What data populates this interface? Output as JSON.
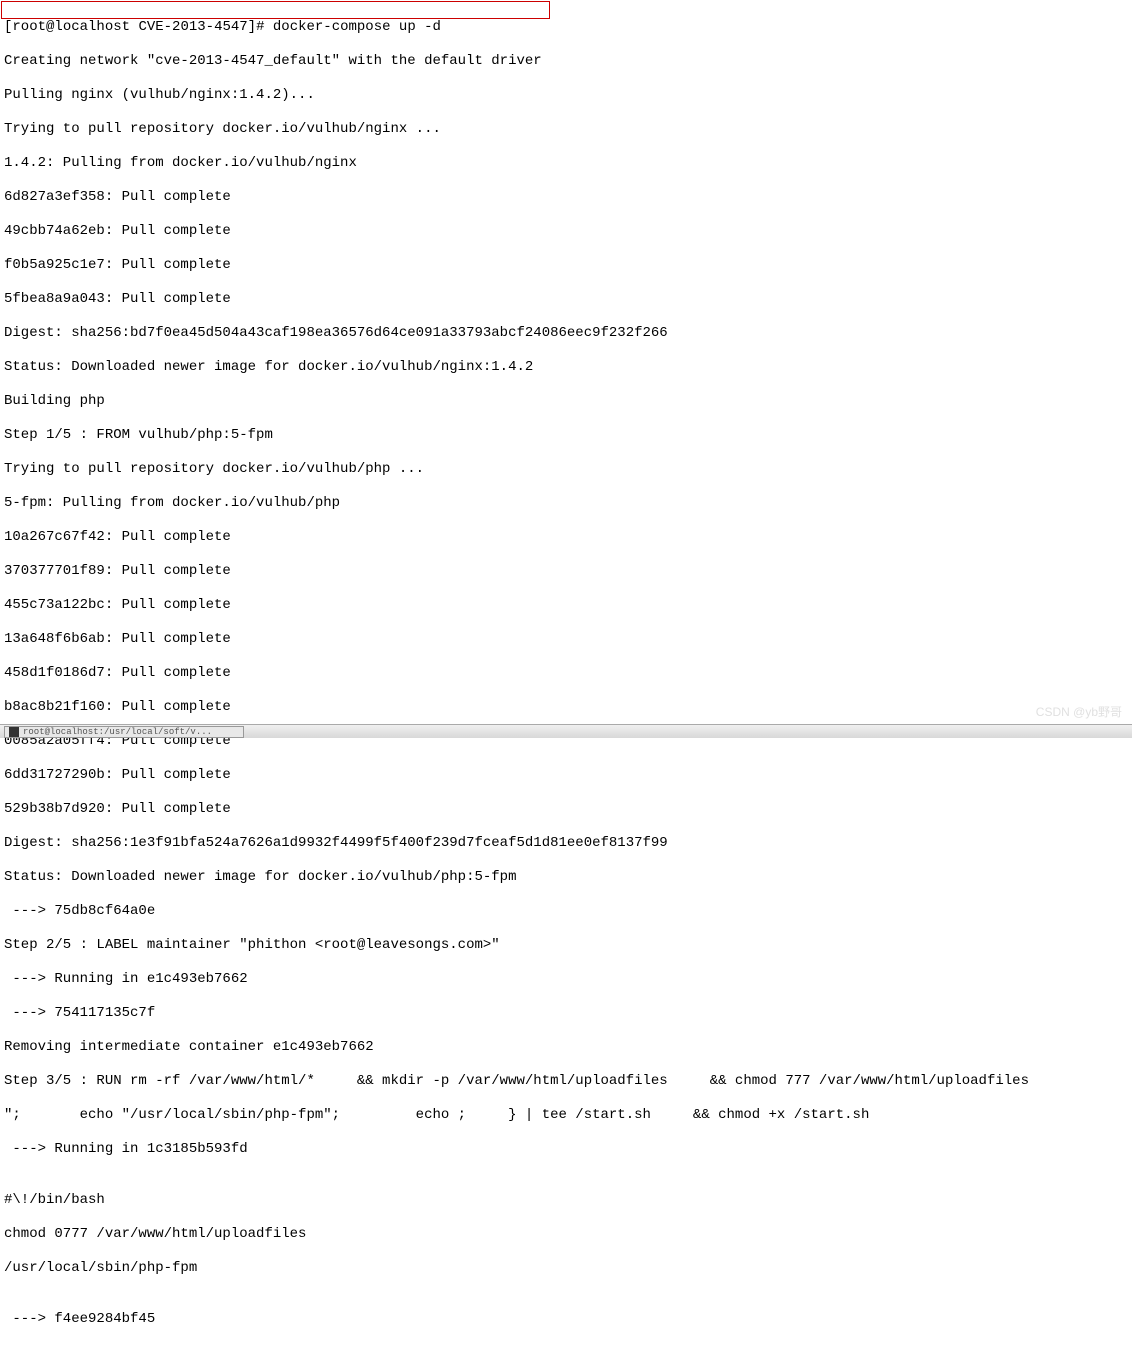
{
  "prompt": {
    "user": "root",
    "host": "localhost",
    "dir": "CVE-2013-4547",
    "symbol": "#",
    "command": "docker-compose up -d"
  },
  "lines": [
    "Creating network \"cve-2013-4547_default\" with the default driver",
    "Pulling nginx (vulhub/nginx:1.4.2)...",
    "Trying to pull repository docker.io/vulhub/nginx ...",
    "1.4.2: Pulling from docker.io/vulhub/nginx",
    "6d827a3ef358: Pull complete",
    "49cbb74a62eb: Pull complete",
    "f0b5a925c1e7: Pull complete",
    "5fbea8a9a043: Pull complete",
    "Digest: sha256:bd7f0ea45d504a43caf198ea36576d64ce091a33793abcf24086eec9f232f266",
    "Status: Downloaded newer image for docker.io/vulhub/nginx:1.4.2",
    "Building php",
    "Step 1/5 : FROM vulhub/php:5-fpm",
    "Trying to pull repository docker.io/vulhub/php ...",
    "5-fpm: Pulling from docker.io/vulhub/php",
    "10a267c67f42: Pull complete",
    "370377701f89: Pull complete",
    "455c73a122bc: Pull complete",
    "13a648f6b6ab: Pull complete",
    "458d1f0186d7: Pull complete",
    "b8ac8b21f160: Pull complete",
    "0085a2a05ff4: Pull complete",
    "6dd31727290b: Pull complete",
    "529b38b7d920: Pull complete",
    "Digest: sha256:1e3f91bfa524a7626a1d9932f4499f5f400f239d7fceaf5d1d81ee0ef8137f99",
    "Status: Downloaded newer image for docker.io/vulhub/php:5-fpm",
    " ---> 75db8cf64a0e",
    "Step 2/5 : LABEL maintainer \"phithon <root@leavesongs.com>\"",
    " ---> Running in e1c493eb7662",
    " ---> 754117135c7f",
    "Removing intermediate container e1c493eb7662",
    "Step 3/5 : RUN rm -rf /var/www/html/*     && mkdir -p /var/www/html/uploadfiles     && chmod 777 /var/www/html/uploadfiles",
    "\";       echo \"/usr/local/sbin/php-fpm\";         echo ;     } | tee /start.sh     && chmod +x /start.sh",
    " ---> Running in 1c3185b593fd",
    "",
    "#\\!/bin/bash",
    "chmod 0777 /var/www/html/uploadfiles",
    "/usr/local/sbin/php-fpm",
    "",
    " ---> f4ee9284bf45"
  ],
  "watermark": "CSDN @yb野哥",
  "taskbar": {
    "item_label": "root@localhost:/usr/local/soft/v..."
  }
}
